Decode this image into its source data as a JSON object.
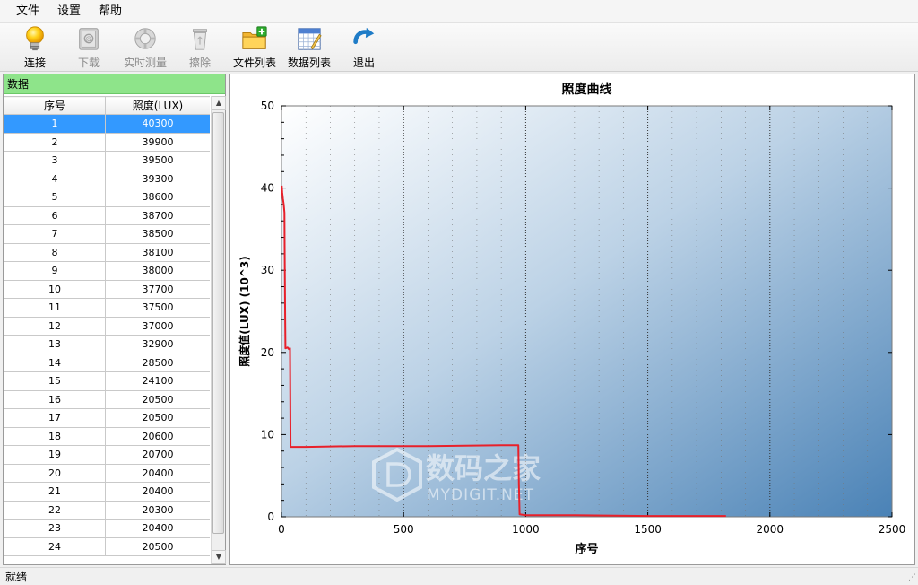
{
  "menu": {
    "items": [
      "文件",
      "设置",
      "帮助"
    ]
  },
  "toolbar": {
    "buttons": [
      {
        "label": "连接",
        "icon": "bulb-icon",
        "enabled": true
      },
      {
        "label": "下载",
        "icon": "safe-icon",
        "enabled": false
      },
      {
        "label": "实时测量",
        "icon": "lifebuoy-icon",
        "enabled": false
      },
      {
        "label": "擦除",
        "icon": "recycle-bin-icon",
        "enabled": false
      },
      {
        "label": "文件列表",
        "icon": "folder-add-icon",
        "enabled": true
      },
      {
        "label": "数据列表",
        "icon": "calendar-icon",
        "enabled": true
      },
      {
        "label": "退出",
        "icon": "exit-arrow-icon",
        "enabled": true
      }
    ]
  },
  "data_panel": {
    "title": "数据",
    "columns": [
      "序号",
      "照度(LUX)"
    ],
    "rows": [
      [
        "1",
        "40300"
      ],
      [
        "2",
        "39900"
      ],
      [
        "3",
        "39500"
      ],
      [
        "4",
        "39300"
      ],
      [
        "5",
        "38600"
      ],
      [
        "6",
        "38700"
      ],
      [
        "7",
        "38500"
      ],
      [
        "8",
        "38100"
      ],
      [
        "9",
        "38000"
      ],
      [
        "10",
        "37700"
      ],
      [
        "11",
        "37500"
      ],
      [
        "12",
        "37000"
      ],
      [
        "13",
        "32900"
      ],
      [
        "14",
        "28500"
      ],
      [
        "15",
        "24100"
      ],
      [
        "16",
        "20500"
      ],
      [
        "17",
        "20500"
      ],
      [
        "18",
        "20600"
      ],
      [
        "19",
        "20700"
      ],
      [
        "20",
        "20400"
      ],
      [
        "21",
        "20400"
      ],
      [
        "22",
        "20300"
      ],
      [
        "23",
        "20400"
      ],
      [
        "24",
        "20500"
      ]
    ],
    "selected_row": 0
  },
  "chart_data": {
    "type": "line",
    "title": "照度曲线",
    "xlabel": "序号",
    "ylabel": "照度值(LUX) (10^3)",
    "xlim": [
      0,
      2500
    ],
    "ylim": [
      0,
      50
    ],
    "xticks": [
      0,
      500,
      1000,
      1500,
      2000,
      2500
    ],
    "yticks": [
      0,
      10,
      20,
      30,
      40,
      50
    ],
    "grid": true,
    "series": [
      {
        "color": "#e8202a",
        "x": [
          1,
          3,
          6,
          9,
          12,
          13,
          14,
          15,
          16,
          25,
          30,
          35,
          37,
          40,
          100,
          300,
          600,
          900,
          970,
          972,
          975,
          1000,
          1200,
          1500,
          1820
        ],
        "y": [
          40.3,
          39.5,
          38.7,
          38.0,
          37.0,
          32.9,
          28.5,
          24.1,
          20.5,
          20.6,
          20.4,
          20.5,
          8.5,
          8.5,
          8.5,
          8.6,
          8.6,
          8.7,
          8.7,
          4.0,
          0.3,
          0.2,
          0.2,
          0.1,
          0.1
        ]
      }
    ]
  },
  "watermark": {
    "brand": "数码之家",
    "url": "MYDIGIT.NET"
  },
  "status": {
    "text": "就绪"
  },
  "colors": {
    "header_green": "#8ee48a",
    "selection_blue": "#3399ff",
    "curve_red": "#e8202a"
  }
}
